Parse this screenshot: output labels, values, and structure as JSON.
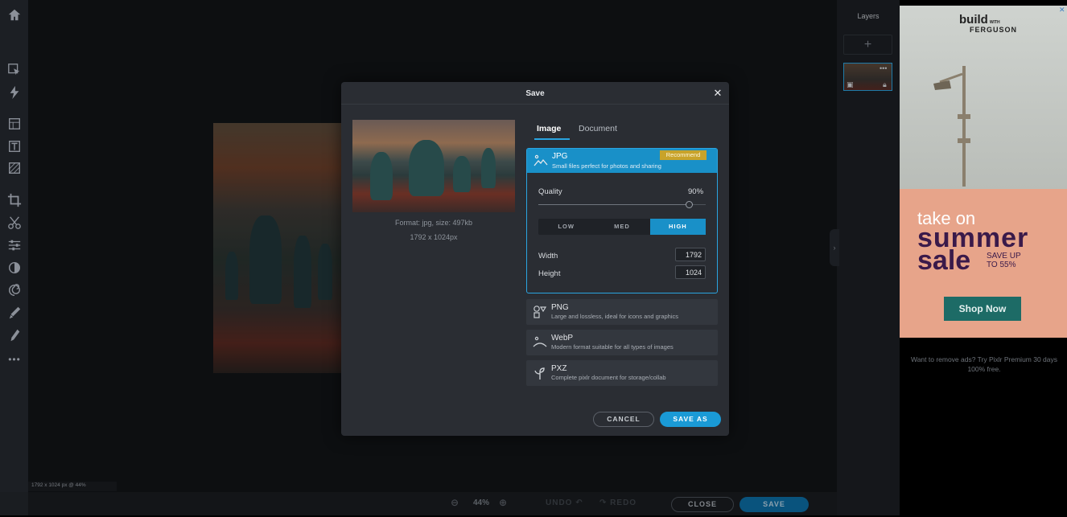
{
  "workspace": {
    "status_text": "1792 x 1024 px @ 44%"
  },
  "bottombar": {
    "zoom": "44%",
    "undo_label": "UNDO",
    "redo_label": "REDO",
    "close_label": "CLOSE",
    "save_label": "SAVE"
  },
  "layers": {
    "title": "Layers",
    "add_label": "+"
  },
  "ad": {
    "brand_line1": "build",
    "brand_with": "WITH",
    "brand_line2": "FERGUSON",
    "take_on": "take on",
    "summer": "summer",
    "sale": "sale",
    "save_up_1": "SAVE UP",
    "save_up_2": "TO 55%",
    "shop_now": "Shop Now",
    "remove_ads": "Want to remove ads? Try Pixlr Premium 30 days 100% free."
  },
  "dialog": {
    "title": "Save",
    "format_info": "Format: jpg, size: 497kb",
    "dims_info": "1792 x 1024px",
    "tabs": [
      {
        "label": "Image",
        "active": true
      },
      {
        "label": "Document",
        "active": false
      }
    ],
    "jpg": {
      "name": "JPG",
      "desc": "Small files perfect for photos and sharing",
      "badge": "Recommend",
      "quality_label": "Quality",
      "quality_value": "90%",
      "quality_fraction": 0.9,
      "levels": [
        "LOW",
        "MED",
        "HIGH"
      ],
      "active_level": "HIGH",
      "width_label": "Width",
      "width_value": "1792",
      "height_label": "Height",
      "height_value": "1024"
    },
    "formats": [
      {
        "name": "PNG",
        "desc": "Large and lossless, ideal for icons and graphics",
        "icon": "png-shapes-icon"
      },
      {
        "name": "WebP",
        "desc": "Modern format suitable for all types of images",
        "icon": "webp-icon"
      },
      {
        "name": "PXZ",
        "desc": "Complete pixlr document for storage/collab",
        "icon": "pxz-icon"
      }
    ],
    "cancel_label": "CANCEL",
    "save_as_label": "SAVE AS"
  },
  "colors": {
    "accent": "#1990c8",
    "badge": "#c8a32a",
    "dialog_bg": "#2a2d33"
  }
}
